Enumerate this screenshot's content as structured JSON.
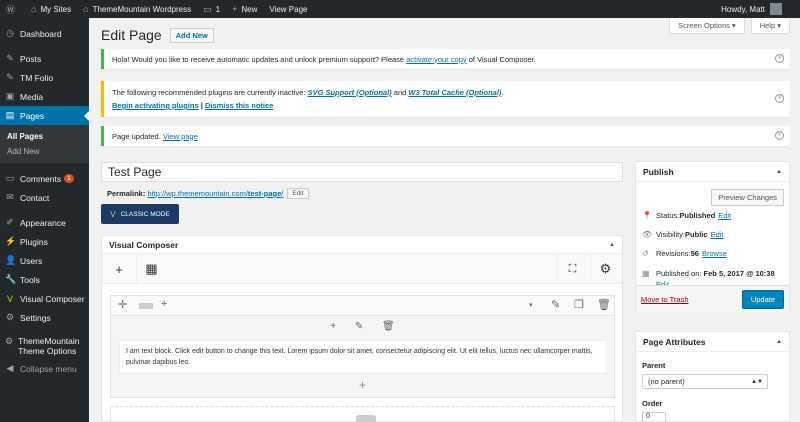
{
  "adminbar": {
    "my_sites": "My Sites",
    "site_name": "ThemeMountain Wordpress",
    "comments_count": "1",
    "new_label": "New",
    "view_page": "View Page",
    "howdy": "Howdy, Matt"
  },
  "sidebar": {
    "items": [
      {
        "label": "Dashboard",
        "icon": "dashboard-icon"
      },
      {
        "label": "Posts",
        "icon": "pin-icon"
      },
      {
        "label": "TM Folio",
        "icon": "pin-icon"
      },
      {
        "label": "Media",
        "icon": "media-icon"
      },
      {
        "label": "Pages",
        "icon": "pages-icon"
      },
      {
        "label": "Comments",
        "icon": "comment-icon",
        "badge": "1"
      },
      {
        "label": "Contact",
        "icon": "mail-icon"
      },
      {
        "label": "Appearance",
        "icon": "brush-icon"
      },
      {
        "label": "Plugins",
        "icon": "plug-icon"
      },
      {
        "label": "Users",
        "icon": "user-icon"
      },
      {
        "label": "Tools",
        "icon": "wrench-icon"
      },
      {
        "label": "Visual Composer",
        "icon": "vc-icon"
      },
      {
        "label": "Settings",
        "icon": "settings-icon"
      },
      {
        "label": "ThemeMountain Theme Options",
        "icon": "gear-icon"
      },
      {
        "label": "Collapse menu",
        "icon": "collapse-icon"
      }
    ],
    "submenu": {
      "all_pages": "All Pages",
      "add_new": "Add New"
    }
  },
  "screen_meta": {
    "screen_options": "Screen Options ▾",
    "help": "Help ▾"
  },
  "header": {
    "title": "Edit Page",
    "add_new": "Add New"
  },
  "notices": {
    "vc_text_before": "Hola! Would you like to receive automatic updates and unlock premium support? Please ",
    "vc_link": "activate your copy",
    "vc_text_after": " of Visual Composer.",
    "plugins_text": "The following recommended plugins are currently inactive: ",
    "plugin1": "SVG Support (Optional)",
    "and": " and ",
    "plugin2": "W3 Total Cache (Optional)",
    "period": ".",
    "begin_link": "Begin activating plugins",
    "pipe": " | ",
    "dismiss_link": "Dismiss this notice",
    "updated_text": "Page updated. ",
    "view_page": "View page"
  },
  "editor": {
    "title_value": "Test Page",
    "permalink_label": "Permalink:",
    "permalink_base": "http://wp.thememountain.com/",
    "permalink_slug": "test-page",
    "permalink_end": "/",
    "edit_btn": "Edit",
    "classic_mode": "CLASSIC MODE"
  },
  "vc": {
    "title": "Visual Composer",
    "text_block": "I am text block. Click edit button to change this text. Lorem ipsum dolor sit amet, consectetur adipiscing elit. Ut elit tellus, luctus nec ullamcorper mattis, pulvinar dapibus leo."
  },
  "publish": {
    "title": "Publish",
    "preview": "Preview Changes",
    "status_label": "Status: ",
    "status_value": "Published",
    "visibility_label": "Visibility: ",
    "visibility_value": "Public",
    "revisions_label": "Revisions: ",
    "revisions_value": "56",
    "browse": "Browse",
    "published_label": "Published on: ",
    "published_value": "Feb 5, 2017 @ 10:38",
    "edit": "Edit",
    "trash": "Move to Trash",
    "update": "Update"
  },
  "page_attributes": {
    "title": "Page Attributes",
    "parent_label": "Parent",
    "parent_value": "(no parent)",
    "order_label": "Order",
    "order_value": "0"
  },
  "colors": {
    "accent": "#0073aa",
    "sidebar": "#23282d",
    "success": "#46b450",
    "warning": "#ffb900",
    "update_button": "#0085ba"
  }
}
